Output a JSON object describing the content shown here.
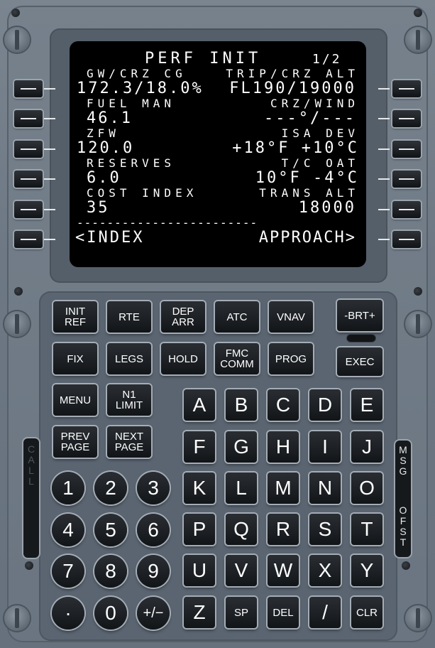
{
  "screen": {
    "title": "PERF INIT",
    "page": "1/2",
    "rows": [
      {
        "left_label": "GW/CRZ CG",
        "right_label": "TRIP/CRZ ALT",
        "left_data": "172.3/18.0%",
        "right_data": "FL190/19000"
      },
      {
        "left_label": "FUEL MAN",
        "right_label": "CRZ/WIND",
        "left_data": "46.1",
        "right_data": "---°/---"
      },
      {
        "left_label": "ZFW",
        "right_label": "ISA DEV",
        "left_data": "120.0",
        "right_data": "+18°F +10°C"
      },
      {
        "left_label": "RESERVES",
        "right_label": "T/C OAT",
        "left_data": "6.0",
        "right_data": "10°F -4°C"
      },
      {
        "left_label": "COST INDEX",
        "right_label": "TRANS ALT",
        "left_data": "35",
        "right_data": "18000"
      }
    ],
    "separator": "------------------------",
    "left_prompt": "<INDEX",
    "right_prompt": "APPROACH>"
  },
  "function_keys": {
    "init_ref": "INIT\nREF",
    "rte": "RTE",
    "dep_arr": "DEP\nARR",
    "atc": "ATC",
    "vnav": "VNAV",
    "brt": "-BRT+",
    "fix": "FIX",
    "legs": "LEGS",
    "hold": "HOLD",
    "fmc_comm": "FMC\nCOMM",
    "prog": "PROG",
    "exec": "EXEC",
    "menu": "MENU",
    "n1_limit": "N1\nLIMIT",
    "prev_page": "PREV\nPAGE",
    "next_page": "NEXT\nPAGE"
  },
  "alpha_keys": [
    "A",
    "B",
    "C",
    "D",
    "E",
    "F",
    "G",
    "H",
    "I",
    "J",
    "K",
    "L",
    "M",
    "N",
    "O",
    "P",
    "Q",
    "R",
    "S",
    "T",
    "U",
    "V",
    "W",
    "X",
    "Y",
    "Z",
    "SP",
    "DEL",
    "/",
    "CLR"
  ],
  "numeric_keys": [
    "1",
    "2",
    "3",
    "4",
    "5",
    "6",
    "7",
    "8",
    "9",
    "·",
    "0",
    "+/−"
  ],
  "annunciators": {
    "call": [
      "C",
      "A",
      "L",
      "L"
    ],
    "msg": [
      "M",
      "S",
      "G"
    ],
    "ofst": [
      "O",
      "F",
      "S",
      "T"
    ]
  }
}
